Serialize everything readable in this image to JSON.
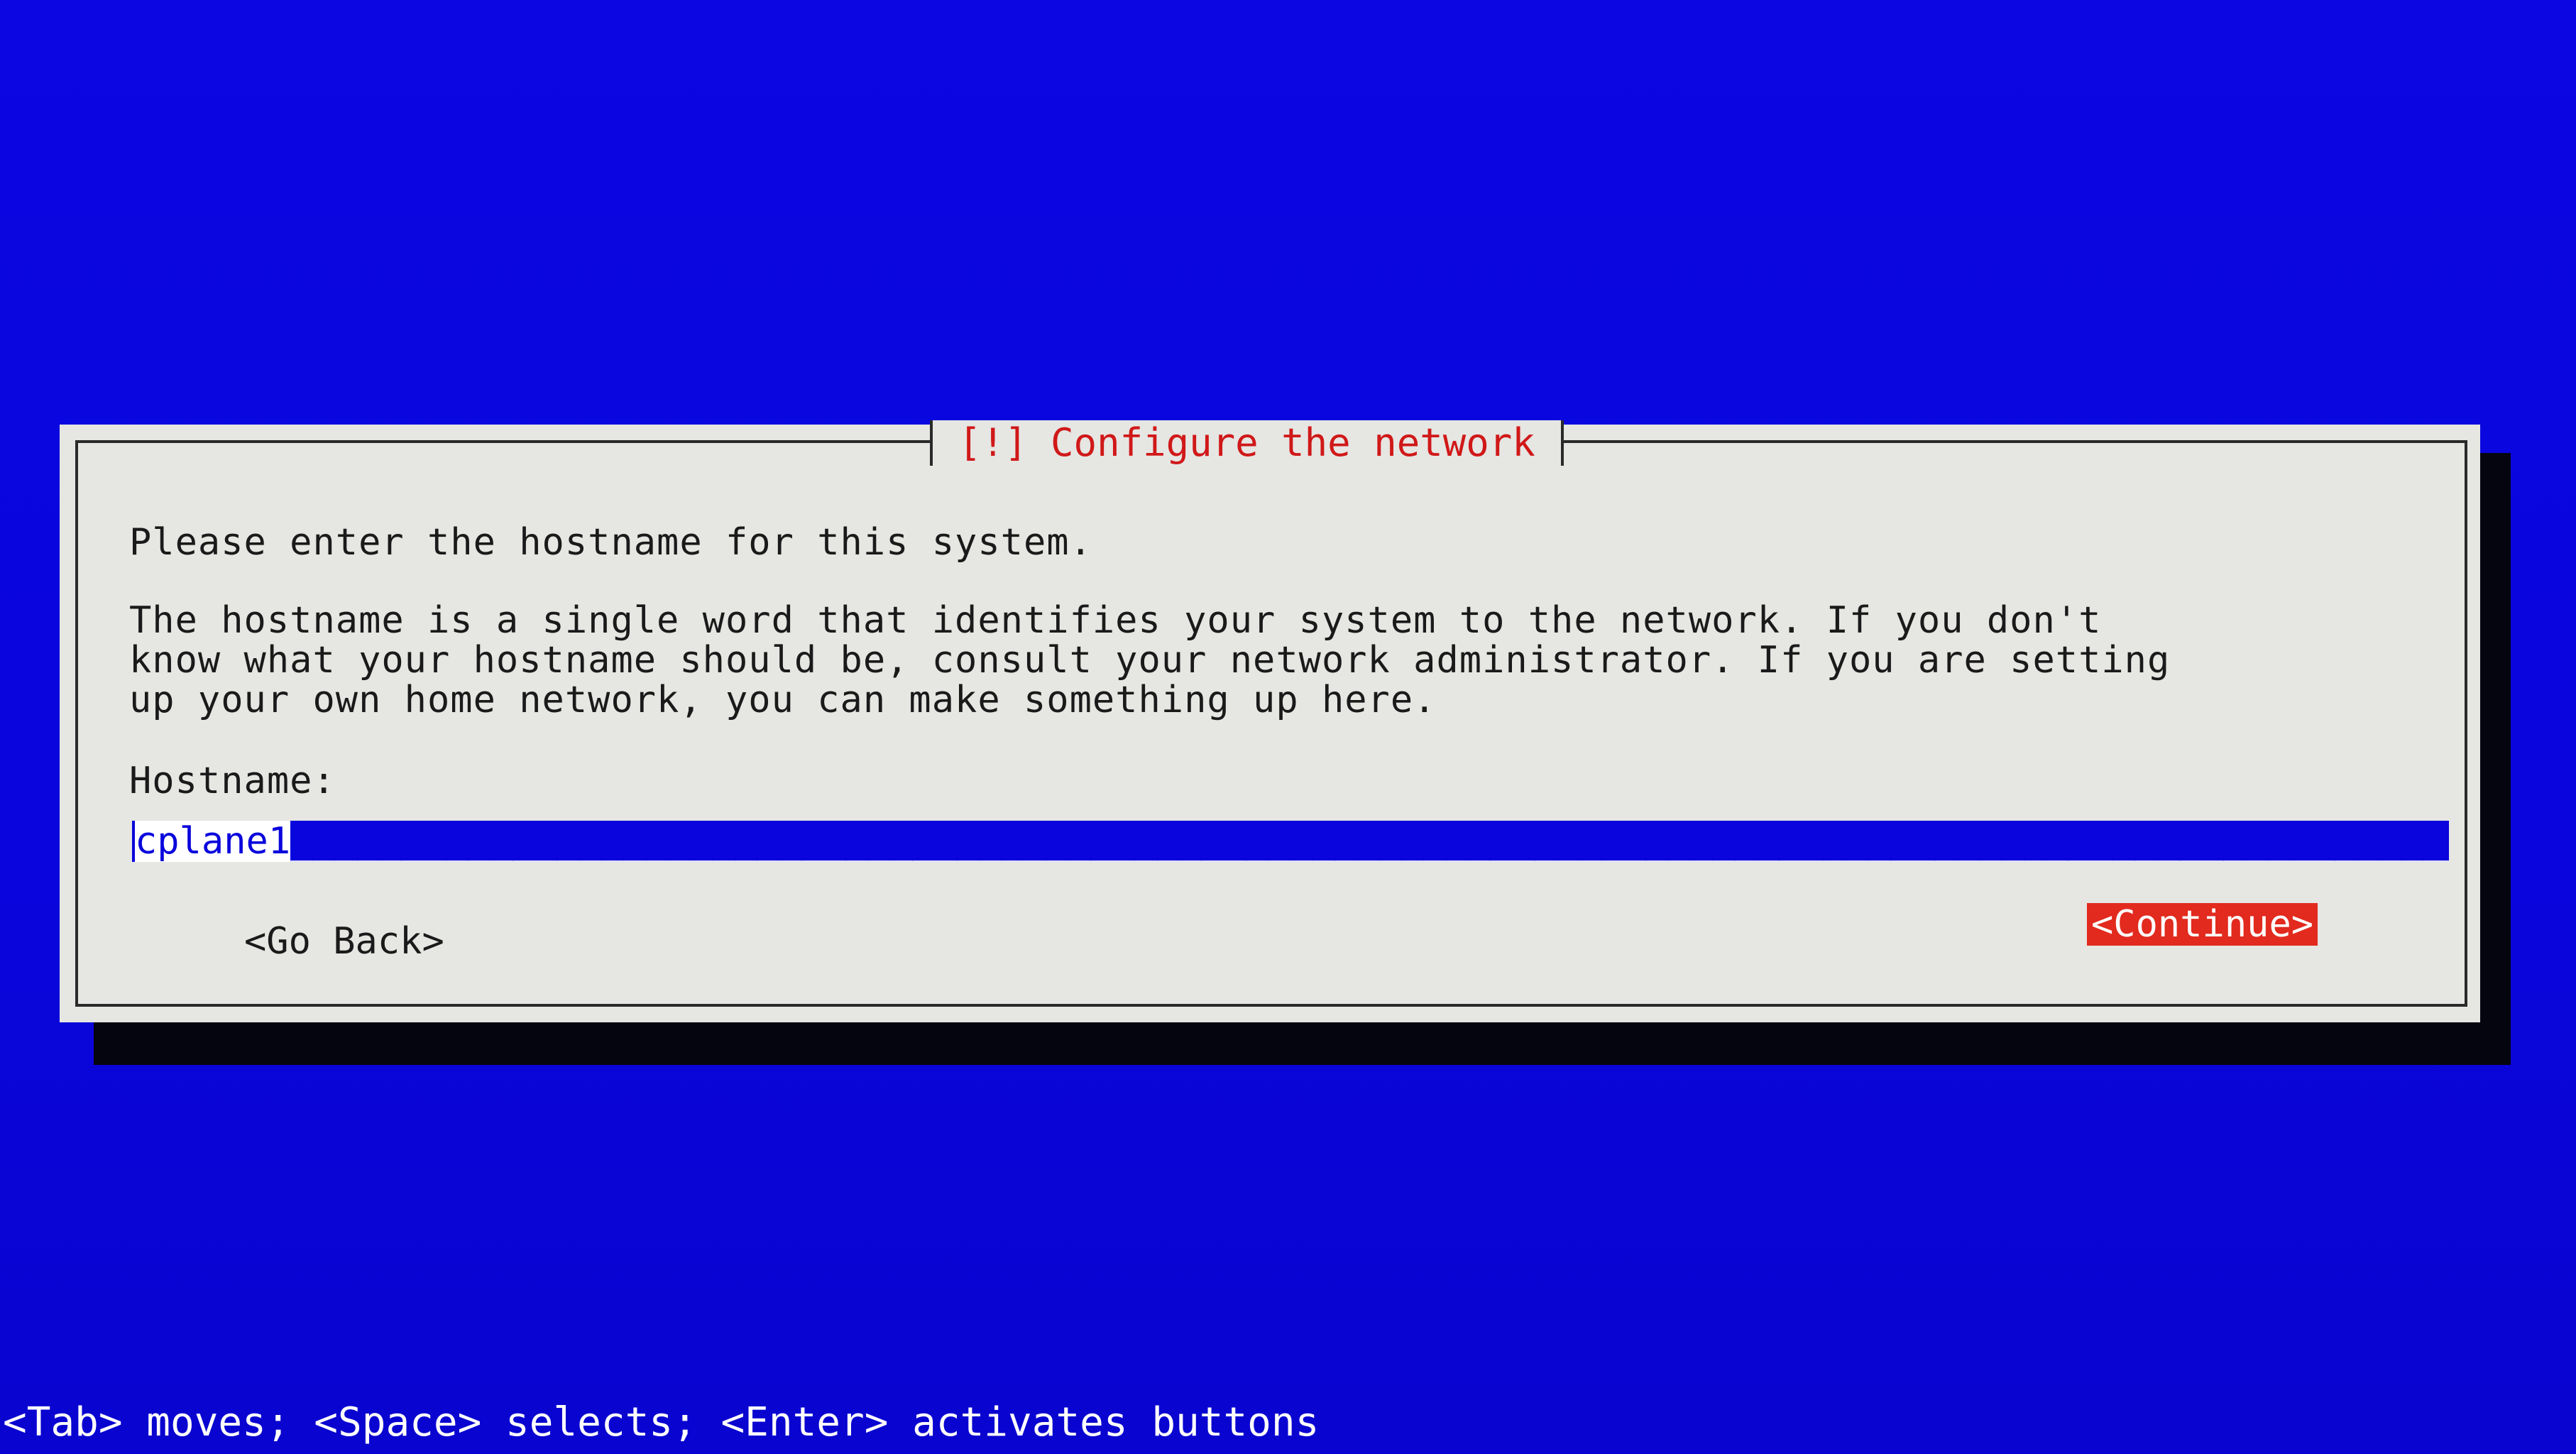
{
  "dialog": {
    "title": "[!] Configure the network",
    "prompt": "Please enter the hostname for this system.",
    "description": "The hostname is a single word that identifies your system to the network. If you don't\nknow what your hostname should be, consult your network administrator. If you are setting\nup your own home network, you can make something up here.",
    "field_label": "Hostname:",
    "hostname_value": "cplane1",
    "go_back_label": "<Go Back>",
    "continue_label": "<Continue>"
  },
  "help_bar": {
    "text": "<Tab> moves; <Space> selects; <Enter> activates buttons"
  },
  "colors": {
    "background": "#0a05dc",
    "dialog": "#e6e6e3",
    "title": "#d01818",
    "focused_button": "#e22a1e",
    "input_field": "#0a05dc"
  }
}
